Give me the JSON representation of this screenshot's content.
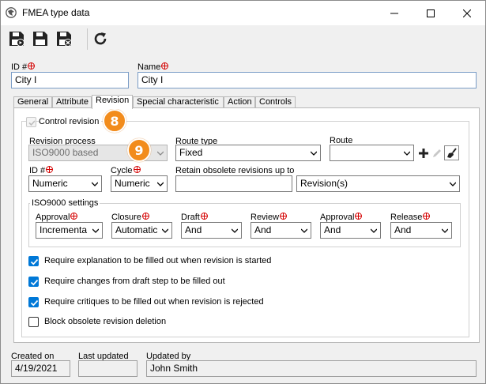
{
  "window": {
    "title": "FMEA type data",
    "controls": {
      "minimize": "minimize",
      "maximize": "maximize",
      "close": "close"
    }
  },
  "toolbar": {
    "buttons": [
      "save-new-icon",
      "save-icon",
      "save-close-icon",
      "refresh-icon"
    ]
  },
  "header": {
    "id_label": "ID #",
    "id_value": "City I",
    "name_label": "Name",
    "name_value": "City I"
  },
  "tabs": [
    {
      "label": "General"
    },
    {
      "label": "Attribute"
    },
    {
      "label": "Revision",
      "active": true
    },
    {
      "label": "Special characteristic"
    },
    {
      "label": "Action"
    },
    {
      "label": "Controls"
    }
  ],
  "revision": {
    "control_revision_label": "Control revision",
    "control_revision_checked": true,
    "revision_process_label": "Revision process",
    "revision_process_value": "ISO9000 based",
    "route_type_label": "Route type",
    "route_type_value": "Fixed",
    "route_label": "Route",
    "route_value": "",
    "id_label": "ID #",
    "id_value": "Numeric",
    "cycle_label": "Cycle",
    "cycle_value": "Numeric",
    "retain_label": "Retain obsolete revisions up to",
    "retain_value": "",
    "retain_unit_value": "Revision(s)"
  },
  "iso9000": {
    "group_label": "ISO9000 settings",
    "fields": [
      {
        "label": "Approval",
        "value": "Incrementa",
        "required": true
      },
      {
        "label": "Closure",
        "value": "Automatic",
        "required": true
      },
      {
        "label": "Draft",
        "value": "And",
        "required": true
      },
      {
        "label": "Review",
        "value": "And",
        "required": true
      },
      {
        "label": "Approval",
        "value": "And",
        "required": true
      },
      {
        "label": "Release",
        "value": "And",
        "required": true
      }
    ]
  },
  "options": [
    {
      "label": "Require explanation to be filled out when revision is started",
      "checked": true
    },
    {
      "label": "Require changes from draft step to be filled out",
      "checked": true
    },
    {
      "label": "Require critiques to be filled out when revision is rejected",
      "checked": true
    },
    {
      "label": "Block obsolete revision deletion",
      "checked": false
    }
  ],
  "callouts": {
    "first": "8",
    "second": "9"
  },
  "footer": {
    "created_label": "Created on",
    "created_value": "4/19/2021",
    "updated_label": "Last updated",
    "updated_value": "",
    "updated_by_label": "Updated by",
    "updated_by_value": "John Smith"
  },
  "colors": {
    "accent": "#0078d7",
    "callout": "#f28c1c",
    "required": "#d40000"
  }
}
